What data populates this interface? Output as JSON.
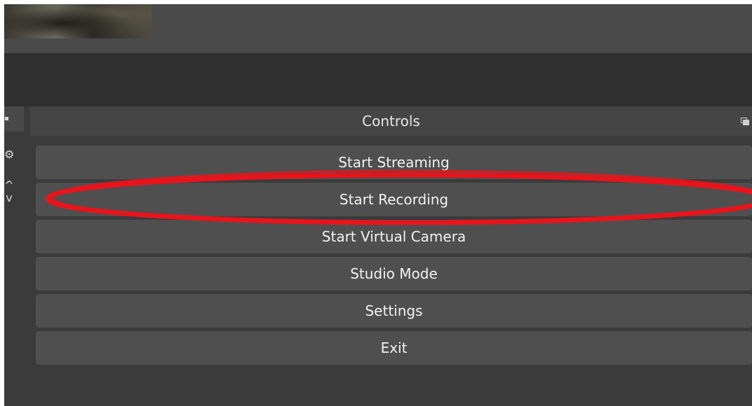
{
  "controls": {
    "title": "Controls",
    "buttons": [
      {
        "label": "Start Streaming"
      },
      {
        "label": "Start Recording"
      },
      {
        "label": "Start Virtual Camera"
      },
      {
        "label": "Studio Mode"
      },
      {
        "label": "Settings"
      },
      {
        "label": "Exit"
      }
    ]
  },
  "icons": {
    "float": "float-window-icon",
    "left_dock_float": "float-window-icon",
    "left_tool_1": "gear-icon",
    "left_tool_2": "chevron-up-icon",
    "left_tool_3": "chevron-down-icon"
  },
  "colors": {
    "background": "#3b3b3b",
    "panel_title": "#454545",
    "button": "#4f4f4f",
    "text": "#f2f2f2",
    "annotation_red": "#e8141c"
  },
  "annotation": {
    "type": "ellipse",
    "target": "Start Recording"
  }
}
